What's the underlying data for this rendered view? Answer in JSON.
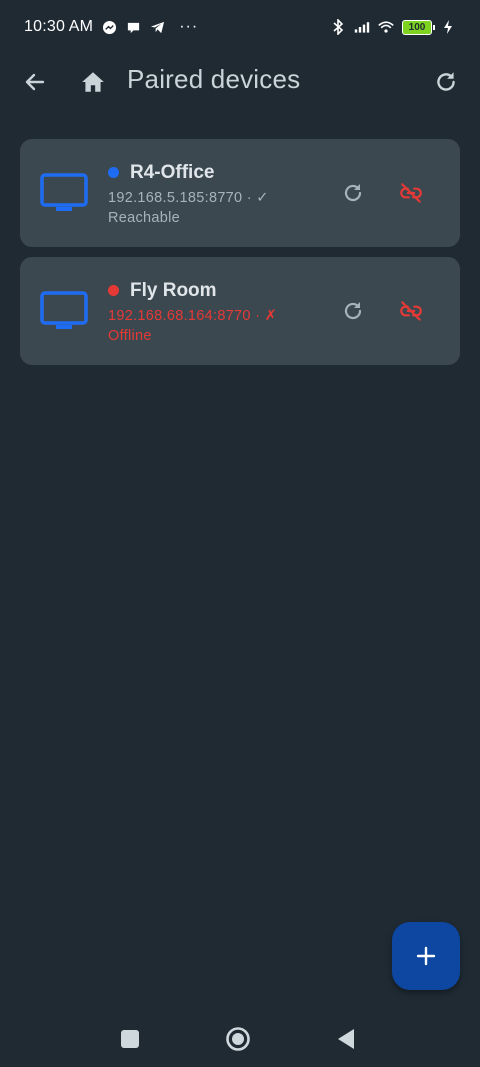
{
  "status_bar": {
    "time": "10:30 AM",
    "battery": "100"
  },
  "app_bar": {
    "title": "Paired devices"
  },
  "devices": [
    {
      "name": "R4-Office",
      "address": "192.168.5.185:8770 · ✓",
      "state": "Reachable",
      "online": true,
      "dot_color": "#1e6cf2",
      "text_color": "#a7b3ba"
    },
    {
      "name": "Fly Room",
      "address": "192.168.68.164:8770 · ✗",
      "state": "Offline",
      "online": false,
      "dot_color": "#e53935",
      "text_color": "#e53935"
    }
  ],
  "colors": {
    "background": "#1f2a33",
    "card": "#3c4850",
    "tv_icon": "#1e6cf2",
    "unlink_icon": "#e53935",
    "fab": "#0d47a1"
  },
  "icons": {
    "back": "arrow-left-icon",
    "home": "home-icon",
    "refresh": "refresh-icon",
    "tv": "tv-icon",
    "unlink": "link-off-icon",
    "add": "plus-icon"
  }
}
